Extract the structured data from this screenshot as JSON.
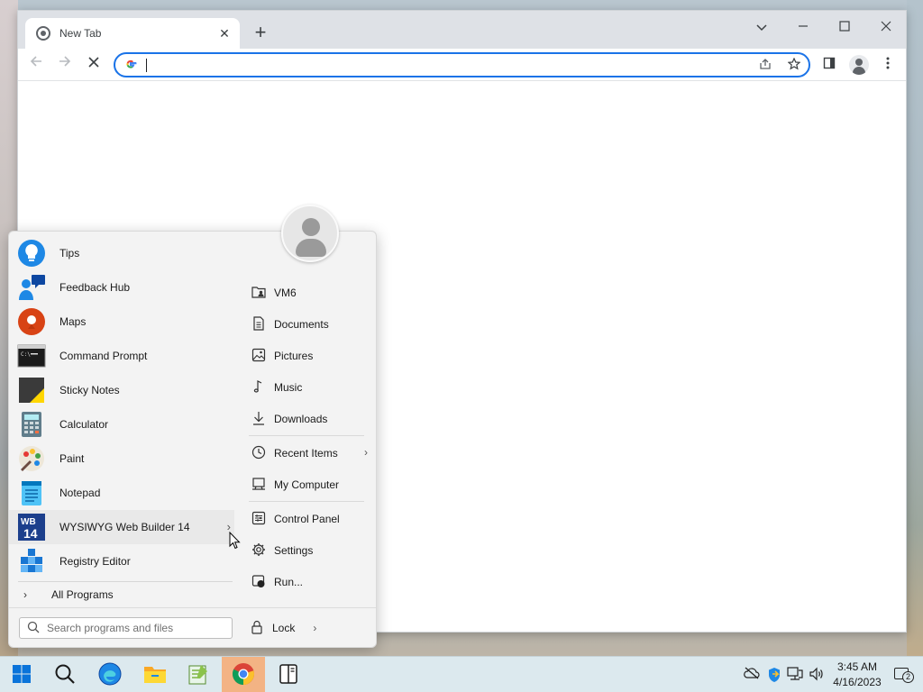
{
  "browser": {
    "tab_title": "New Tab",
    "address_value": ""
  },
  "start_menu": {
    "programs": [
      {
        "label": "Tips",
        "icon": "lightbulb-icon"
      },
      {
        "label": "Feedback Hub",
        "icon": "feedback-hub-icon"
      },
      {
        "label": "Maps",
        "icon": "map-pin-icon"
      },
      {
        "label": "Command Prompt",
        "icon": "command-prompt-icon"
      },
      {
        "label": "Sticky Notes",
        "icon": "sticky-notes-icon"
      },
      {
        "label": "Calculator",
        "icon": "calculator-icon"
      },
      {
        "label": "Paint",
        "icon": "paint-palette-icon"
      },
      {
        "label": "Notepad",
        "icon": "notepad-icon"
      },
      {
        "label": "WYSIWYG Web Builder 14",
        "icon": "web-builder-icon",
        "has_submenu": true
      },
      {
        "label": "Registry Editor",
        "icon": "registry-editor-icon"
      }
    ],
    "all_programs": "All Programs",
    "search_placeholder": "Search programs and files",
    "places": [
      {
        "label": "VM6",
        "icon": "user-folder-icon"
      },
      {
        "label": "Documents",
        "icon": "document-icon"
      },
      {
        "label": "Pictures",
        "icon": "picture-icon"
      },
      {
        "label": "Music",
        "icon": "music-note-icon"
      },
      {
        "label": "Downloads",
        "icon": "download-icon"
      },
      {
        "label": "Recent Items",
        "icon": "clock-icon",
        "has_submenu": true
      },
      {
        "label": "My Computer",
        "icon": "computer-icon"
      },
      {
        "label": "Control Panel",
        "icon": "control-panel-icon"
      },
      {
        "label": "Settings",
        "icon": "gear-icon"
      },
      {
        "label": "Run...",
        "icon": "run-icon"
      }
    ],
    "lock_label": "Lock"
  },
  "taskbar": {
    "apps": [
      "start-icon",
      "search-icon",
      "edge-icon",
      "file-explorer-icon",
      "notepad-plus-icon",
      "chrome-icon",
      "reader-icon"
    ],
    "active_app": "chrome-icon",
    "time": "3:45 AM",
    "date": "4/16/2023",
    "notification_count": "2"
  },
  "colors": {
    "accent": "#1a73e8",
    "taskbar_bg": "#dce9ee",
    "active_taskbar": "#f3b384"
  }
}
